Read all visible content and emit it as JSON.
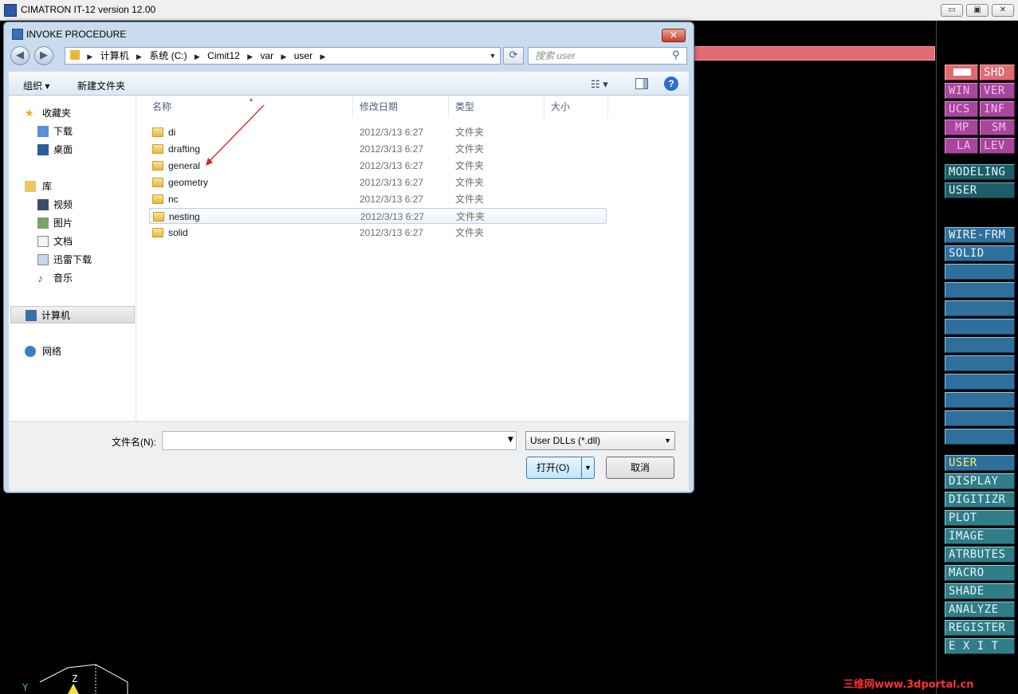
{
  "app": {
    "title": "CIMATRON IT-12 version 12.00",
    "min_label": "▭",
    "max_label": "▣",
    "close_label": "✕"
  },
  "menu": {
    "top_grid": [
      {
        "label": "",
        "style": "red"
      },
      {
        "label": "SHD",
        "style": "red"
      },
      {
        "label": "WIN",
        "style": "magenta"
      },
      {
        "label": "VER",
        "style": "magenta"
      },
      {
        "label": "UCS",
        "style": "magenta"
      },
      {
        "label": "INF",
        "style": "magenta"
      },
      {
        "label": "MP",
        "style": "magenta"
      },
      {
        "label": "SM",
        "style": "magenta"
      },
      {
        "label": "LA",
        "style": "magenta"
      },
      {
        "label": "LEV",
        "style": "magenta"
      }
    ],
    "context": [
      "MODELING",
      "USER"
    ],
    "user_items": [
      "WIRE-FRM",
      "SOLID",
      "",
      "",
      "",
      "",
      "",
      "",
      "",
      "",
      ""
    ],
    "main": [
      "USER",
      "DISPLAY",
      "DIGITIZR",
      "PLOT",
      "IMAGE",
      "ATRBUTES",
      "MACRO",
      "SHADE",
      "ANALYZE",
      "REGISTER",
      "E X I T"
    ],
    "active_main": "USER"
  },
  "dialog": {
    "title": "INVOKE PROCEDURE",
    "close_label": "✕",
    "back_label": "◀",
    "forward_label": "▶",
    "breadcrumb": [
      "计算机",
      "系统 (C:)",
      "Cimit12",
      "var",
      "user"
    ],
    "search_placeholder": "搜索 user",
    "organize_label": "组织 ▾",
    "new_folder_label": "新建文件夹",
    "help_label": "?",
    "sidebar": [
      {
        "label": "收藏夹",
        "icon": "star-icon"
      },
      {
        "label": "下载",
        "icon": "download-folder-icon"
      },
      {
        "label": "桌面",
        "icon": "desktop-icon"
      },
      {
        "label": "库",
        "icon": "library-icon"
      },
      {
        "label": "视频",
        "icon": "video-icon"
      },
      {
        "label": "图片",
        "icon": "picture-icon"
      },
      {
        "label": "文档",
        "icon": "document-icon"
      },
      {
        "label": "迅雷下载",
        "icon": "thunder-download-icon"
      },
      {
        "label": "音乐",
        "icon": "music-icon"
      },
      {
        "label": "计算机",
        "icon": "computer-icon"
      },
      {
        "label": "网络",
        "icon": "network-icon"
      }
    ],
    "columns": [
      "名称",
      "修改日期",
      "类型",
      "大小"
    ],
    "files": [
      {
        "name": "di",
        "date": "2012/3/13 6:27",
        "type": "文件夹"
      },
      {
        "name": "drafting",
        "date": "2012/3/13 6:27",
        "type": "文件夹"
      },
      {
        "name": "general",
        "date": "2012/3/13 6:27",
        "type": "文件夹"
      },
      {
        "name": "geometry",
        "date": "2012/3/13 6:27",
        "type": "文件夹"
      },
      {
        "name": "nc",
        "date": "2012/3/13 6:27",
        "type": "文件夹"
      },
      {
        "name": "nesting",
        "date": "2012/3/13 6:27",
        "type": "文件夹"
      },
      {
        "name": "solid",
        "date": "2012/3/13 6:27",
        "type": "文件夹"
      }
    ],
    "filename_label": "文件名(N):",
    "filename_value": "",
    "filter_value": "User DLLs (*.dll)",
    "open_label": "打开(O)",
    "cancel_label": "取消"
  },
  "viewport": {
    "axis_y": "Y",
    "axis_z": "Z"
  },
  "watermark": "三维网www.3dportal.cn",
  "colors": {
    "menu_magenta": "#a8459e",
    "menu_red": "#e06b72",
    "menu_teal": "#2f7d88",
    "menu_active_text": "#f4ef6a"
  }
}
